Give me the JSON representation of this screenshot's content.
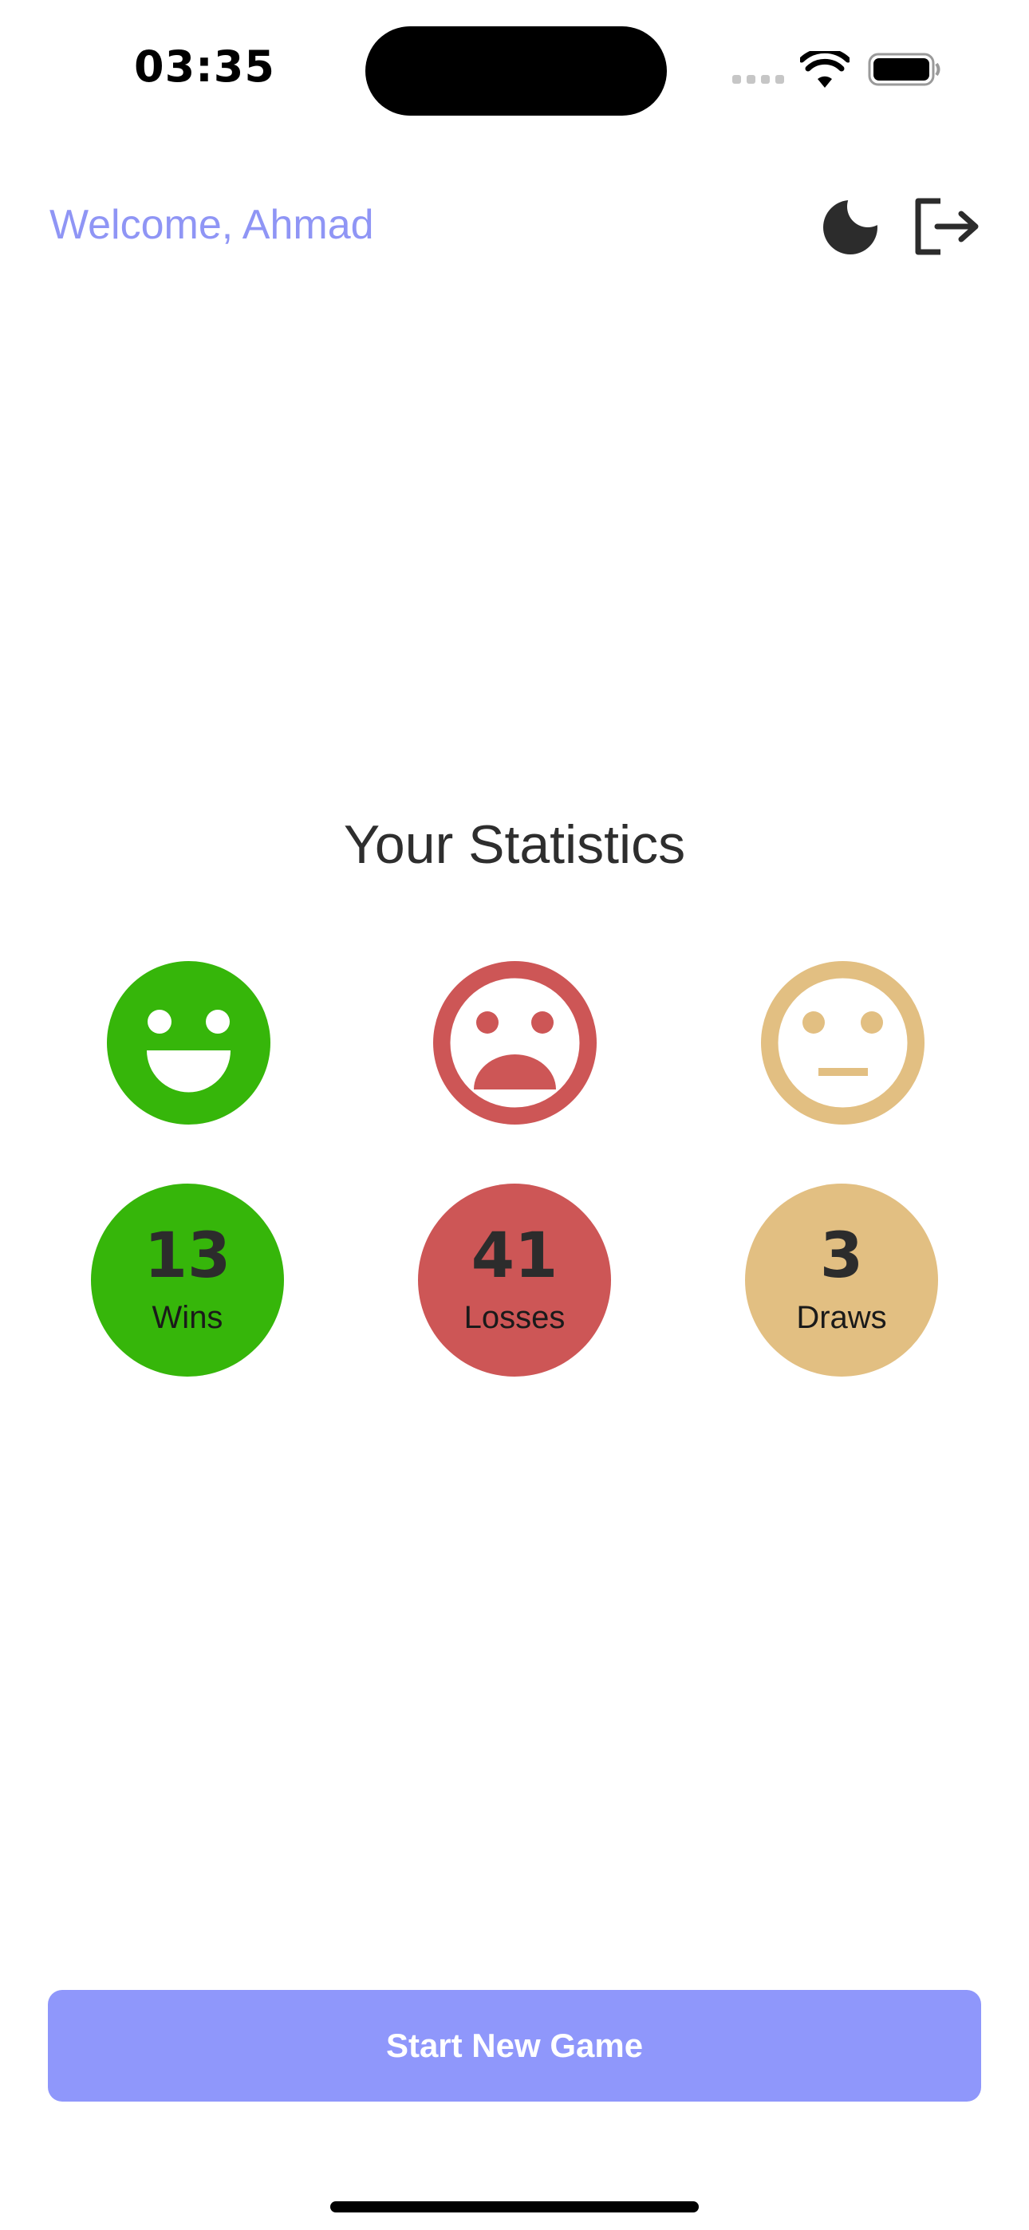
{
  "status_bar": {
    "time": "03:35",
    "icons": [
      "cellular-signal-icon",
      "wifi-icon",
      "battery-icon"
    ]
  },
  "header": {
    "welcome_text": "Welcome, Ahmad",
    "actions": [
      "moon-icon",
      "logout-icon"
    ]
  },
  "statistics": {
    "title": "Your Statistics",
    "items": [
      {
        "key": "wins",
        "count": "13",
        "label": "Wins",
        "icon": "smiling-face-icon",
        "color": "#36b60a"
      },
      {
        "key": "losses",
        "count": "41",
        "label": "Losses",
        "icon": "frowning-face-icon",
        "color": "#cd5656"
      },
      {
        "key": "draws",
        "count": "3",
        "label": "Draws",
        "icon": "neutral-face-icon",
        "color": "#e2bf82"
      }
    ]
  },
  "actions": {
    "start_button_label": "Start New Game",
    "accent_color": "#8f97fb"
  },
  "colors": {
    "welcome_text": "#8f95f5",
    "text_dark": "#2b2b2b"
  }
}
